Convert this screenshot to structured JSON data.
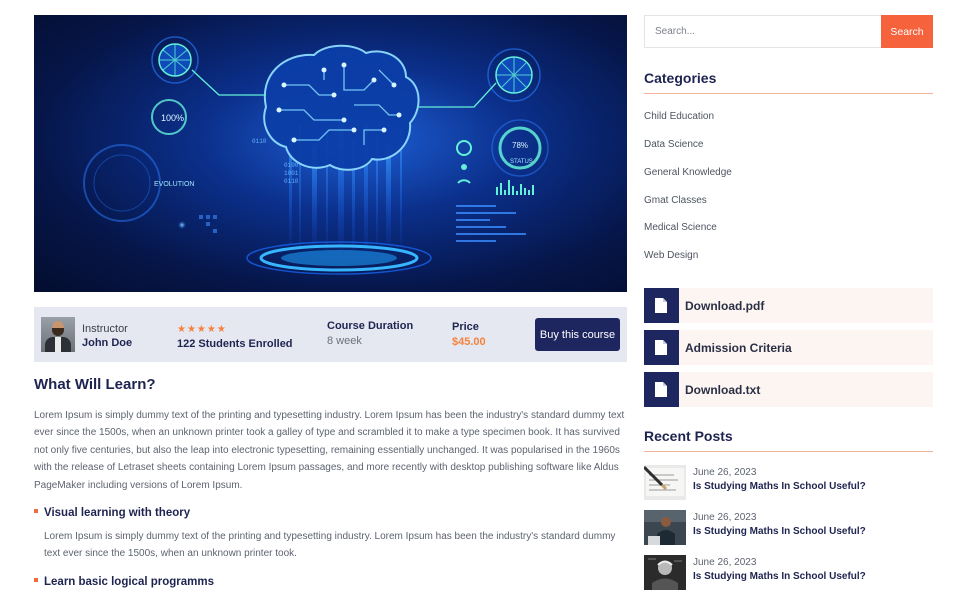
{
  "hero": {
    "overlay_texts": [
      "100%",
      "EVOLUTION",
      "78%",
      "STATUS",
      "0110",
      "0100",
      "1001",
      "0110"
    ]
  },
  "course_info": {
    "instructor_label": "Instructor",
    "instructor_name": "John Doe",
    "rating_stars": "★★★★★",
    "rating": 5,
    "enrolled": "122 Students Enrolled",
    "duration_label": "Course Duration",
    "duration_value": "8 week",
    "price_label": "Price",
    "price_value": "$45.00",
    "buy_label": "Buy this course"
  },
  "content": {
    "title": "What Will Learn?",
    "paragraph": "Lorem Ipsum is simply dummy text of the printing and typesetting industry. Lorem Ipsum has been the industry's standard dummy text ever since the 1500s, when an unknown printer took a galley of type and scrambled it to make a type specimen book. It has survived not only five centuries, but also the leap into electronic typesetting, remaining essentially unchanged. It was popularised in the 1960s with the release of Letraset sheets containing Lorem Ipsum passages, and more recently with desktop publishing software like Aldus PageMaker including versions of Lorem Ipsum.",
    "bullets": [
      {
        "title": "Visual learning with theory",
        "text": "Lorem Ipsum is simply dummy text of the printing and typesetting industry. Lorem Ipsum has been the industry's standard dummy text ever since the 1500s, when an unknown printer took."
      },
      {
        "title": "Learn basic logical programms"
      }
    ]
  },
  "sidebar": {
    "search": {
      "placeholder": "Search...",
      "button": "Search"
    },
    "categories_title": "Categories",
    "categories": [
      "Child Education",
      "Data Science",
      "General Knowledge",
      "Gmat Classes",
      "Medical Science",
      "Web Design"
    ],
    "downloads": [
      "Download.pdf",
      "Admission Criteria",
      "Download.txt"
    ],
    "recent_posts_title": "Recent Posts",
    "recent_posts": [
      {
        "date": "June 26, 2023",
        "title": "Is Studying Maths In School Useful?"
      },
      {
        "date": "June 26, 2023",
        "title": "Is Studying Maths In School Useful?"
      },
      {
        "date": "June 26, 2023",
        "title": "Is Studying Maths In School Useful?"
      }
    ]
  },
  "colors": {
    "navy": "#1e2450",
    "button_navy": "#1e2660",
    "accent_orange": "#f5623c",
    "price_orange": "#f5823e"
  }
}
